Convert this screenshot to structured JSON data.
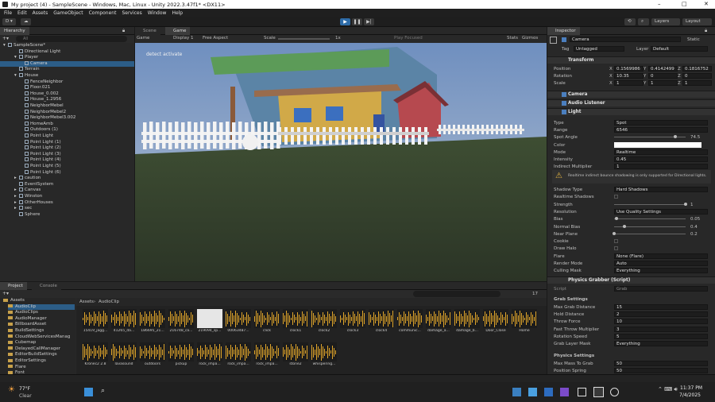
{
  "window": {
    "title": "My project (4) - SampleScene - Windows, Mac, Linux - Unity 2022.3.47f1* <DX11>",
    "min": "–",
    "max": "□",
    "close": "✕"
  },
  "menu": [
    "File",
    "Edit",
    "Assets",
    "GameObject",
    "Component",
    "Services",
    "Window",
    "Help"
  ],
  "toolbar": {
    "account": "D ▾",
    "layers": "Layers",
    "layout": "Layout"
  },
  "hierarchy": {
    "tab": "Hierarchy",
    "search_placeholder": "All",
    "items": [
      {
        "label": "SampleScene*",
        "indent": 0,
        "arrow": "▾"
      },
      {
        "label": "Directional Light",
        "indent": 2
      },
      {
        "label": "Player",
        "indent": 2,
        "arrow": "▾"
      },
      {
        "label": "Camera",
        "indent": 3,
        "selected": true
      },
      {
        "label": "Terrain",
        "indent": 2
      },
      {
        "label": "House",
        "indent": 2,
        "arrow": "▾"
      },
      {
        "label": "FenceNeighbor",
        "indent": 3
      },
      {
        "label": "Floor.021",
        "indent": 3
      },
      {
        "label": "House_0.002",
        "indent": 3
      },
      {
        "label": "House_1.2956",
        "indent": 3
      },
      {
        "label": "NeighborMebel",
        "indent": 3
      },
      {
        "label": "NeighborMebel2",
        "indent": 3
      },
      {
        "label": "NeighborMebel3.002",
        "indent": 3
      },
      {
        "label": "HomeAmb",
        "indent": 3
      },
      {
        "label": "Outdoors (1)",
        "indent": 3
      },
      {
        "label": "Point Light",
        "indent": 3
      },
      {
        "label": "Point Light (1)",
        "indent": 3
      },
      {
        "label": "Point Light (2)",
        "indent": 3
      },
      {
        "label": "Point Light (3)",
        "indent": 3
      },
      {
        "label": "Point Light (4)",
        "indent": 3
      },
      {
        "label": "Point Light (5)",
        "indent": 3
      },
      {
        "label": "Point Light (6)",
        "indent": 3
      },
      {
        "label": "caution",
        "indent": 2,
        "arrow": "▸"
      },
      {
        "label": "EventSystem",
        "indent": 2
      },
      {
        "label": "Canvas",
        "indent": 2,
        "arrow": "▸"
      },
      {
        "label": "Winston",
        "indent": 2,
        "arrow": "▸"
      },
      {
        "label": "OtherHouses",
        "indent": 2,
        "arrow": "▸"
      },
      {
        "label": "sec",
        "indent": 2,
        "arrow": "▸"
      },
      {
        "label": "Sphere",
        "indent": 2
      }
    ]
  },
  "game": {
    "tabs": [
      "Scene",
      "Game"
    ],
    "display_mode": "Game",
    "display": "Display 1",
    "aspect": "Free Aspect",
    "scale_label": "Scale",
    "scale_value": "1x",
    "play_focused": "Play Focused",
    "stats": "Stats",
    "gizmos": "Gizmos",
    "overlay_text": "detect activate"
  },
  "inspector": {
    "tab": "Inspector",
    "object_name": "Camera",
    "static": "Static",
    "tag_label": "Tag",
    "tag": "Untagged",
    "layer_label": "Layer",
    "layer": "Default",
    "transform": {
      "title": "Transform",
      "position": {
        "label": "Position",
        "x": "0.1569986",
        "y": "0.4142499",
        "z": "0.1816752"
      },
      "rotation": {
        "label": "Rotation",
        "x": "10.35",
        "y": "0",
        "z": "0"
      },
      "scale": {
        "label": "Scale",
        "x": "1",
        "y": "1",
        "z": "1"
      }
    },
    "components": [
      "Camera",
      "Audio Listener",
      "Light"
    ],
    "light": [
      {
        "label": "Type",
        "value": "Spot",
        "dropdown": true
      },
      {
        "label": "Range",
        "value": "6546"
      },
      {
        "label": "Spot Angle",
        "value": "74.5",
        "slider": 0.85
      },
      {
        "label": "Color",
        "value": "",
        "color": "#ffffff"
      },
      {
        "label": "Mode",
        "value": "Realtime",
        "dropdown": true
      },
      {
        "label": "Intensity",
        "value": "0.45"
      },
      {
        "label": "Indirect Multiplier",
        "value": "1"
      }
    ],
    "warning": "Realtime indirect bounce shadowing is only supported for Directional lights.",
    "shadow": [
      {
        "label": "Shadow Type",
        "value": "Hard Shadows",
        "dropdown": true
      },
      {
        "label": "Realtime Shadows",
        "value": ""
      },
      {
        "label": "Strength",
        "value": "1",
        "slider": 1.0
      },
      {
        "label": "Resolution",
        "value": "Use Quality Settings",
        "dropdown": true
      },
      {
        "label": "Bias",
        "value": "0.05",
        "slider": 0.03
      },
      {
        "label": "Normal Bias",
        "value": "0.4",
        "slider": 0.14
      },
      {
        "label": "Near Plane",
        "value": "0.2",
        "slider": 0.0
      },
      {
        "label": "Cookie",
        "value": ""
      },
      {
        "label": "Draw Halo",
        "value": ""
      },
      {
        "label": "Flare",
        "value": "None (Flare)"
      },
      {
        "label": "Render Mode",
        "value": "Auto",
        "dropdown": true
      },
      {
        "label": "Culling Mask",
        "value": "Everything",
        "dropdown": true
      }
    ],
    "grabber_title": "Physics Grabber (Script)",
    "script_label": "Script",
    "script_value": "Grab",
    "grab_settings_header": "Grab Settings",
    "grab_settings": [
      {
        "label": "Max Grab Distance",
        "value": "15"
      },
      {
        "label": "Hold Distance",
        "value": "2"
      },
      {
        "label": "Throw Force",
        "value": "10"
      },
      {
        "label": "Fast Throw Multiplier",
        "value": "3"
      },
      {
        "label": "Rotation Speed",
        "value": "5"
      },
      {
        "label": "Grab Layer Mask",
        "value": "Everything",
        "dropdown": true
      }
    ],
    "physics_header": "Physics Settings",
    "physics": [
      {
        "label": "Max Mass To Grab",
        "value": "50"
      },
      {
        "label": "Position Spring",
        "value": "50"
      }
    ]
  },
  "project": {
    "tabs": [
      "Project",
      "Console"
    ],
    "breadcrumb": [
      "Assets",
      "AudioClip"
    ],
    "count": "17",
    "folders": [
      {
        "label": "Assets",
        "indent": 0
      },
      {
        "label": "AudioClip",
        "indent": 1,
        "selected": true
      },
      {
        "label": "AudioClips",
        "indent": 1
      },
      {
        "label": "AudioManager",
        "indent": 1
      },
      {
        "label": "BillboardAsset",
        "indent": 1
      },
      {
        "label": "BuildSettings",
        "indent": 1
      },
      {
        "label": "CloudWebServicesManag",
        "indent": 1
      },
      {
        "label": "Cubemap",
        "indent": 1
      },
      {
        "label": "DelayedCallManager",
        "indent": 1
      },
      {
        "label": "EditorBuildSettings",
        "indent": 1
      },
      {
        "label": "EditorSettings",
        "indent": 1
      },
      {
        "label": "Flare",
        "indent": 1
      },
      {
        "label": "Font",
        "indent": 1
      }
    ],
    "assets": [
      "15419_jagg...",
      "41265_da...",
      "186695_21...",
      "216748_ca...",
      "219094_sp...",
      "00063487...",
      "click",
      "clock1",
      "clock2",
      "clock3",
      "clock4",
      "communic...",
      "damage_a...",
      "damage_b...",
      "Door_Close",
      "Home",
      "Kronec2 2.8",
      "lavasound",
      "outdoors",
      "pickup",
      "rock_impa...",
      "rock_impa...",
      "rock_impa...",
      "stone2",
      "whispering..."
    ]
  },
  "taskbar": {
    "temp": "77°F",
    "weather": "Clear",
    "time": "11:37 PM",
    "date": "7/4/2025"
  }
}
